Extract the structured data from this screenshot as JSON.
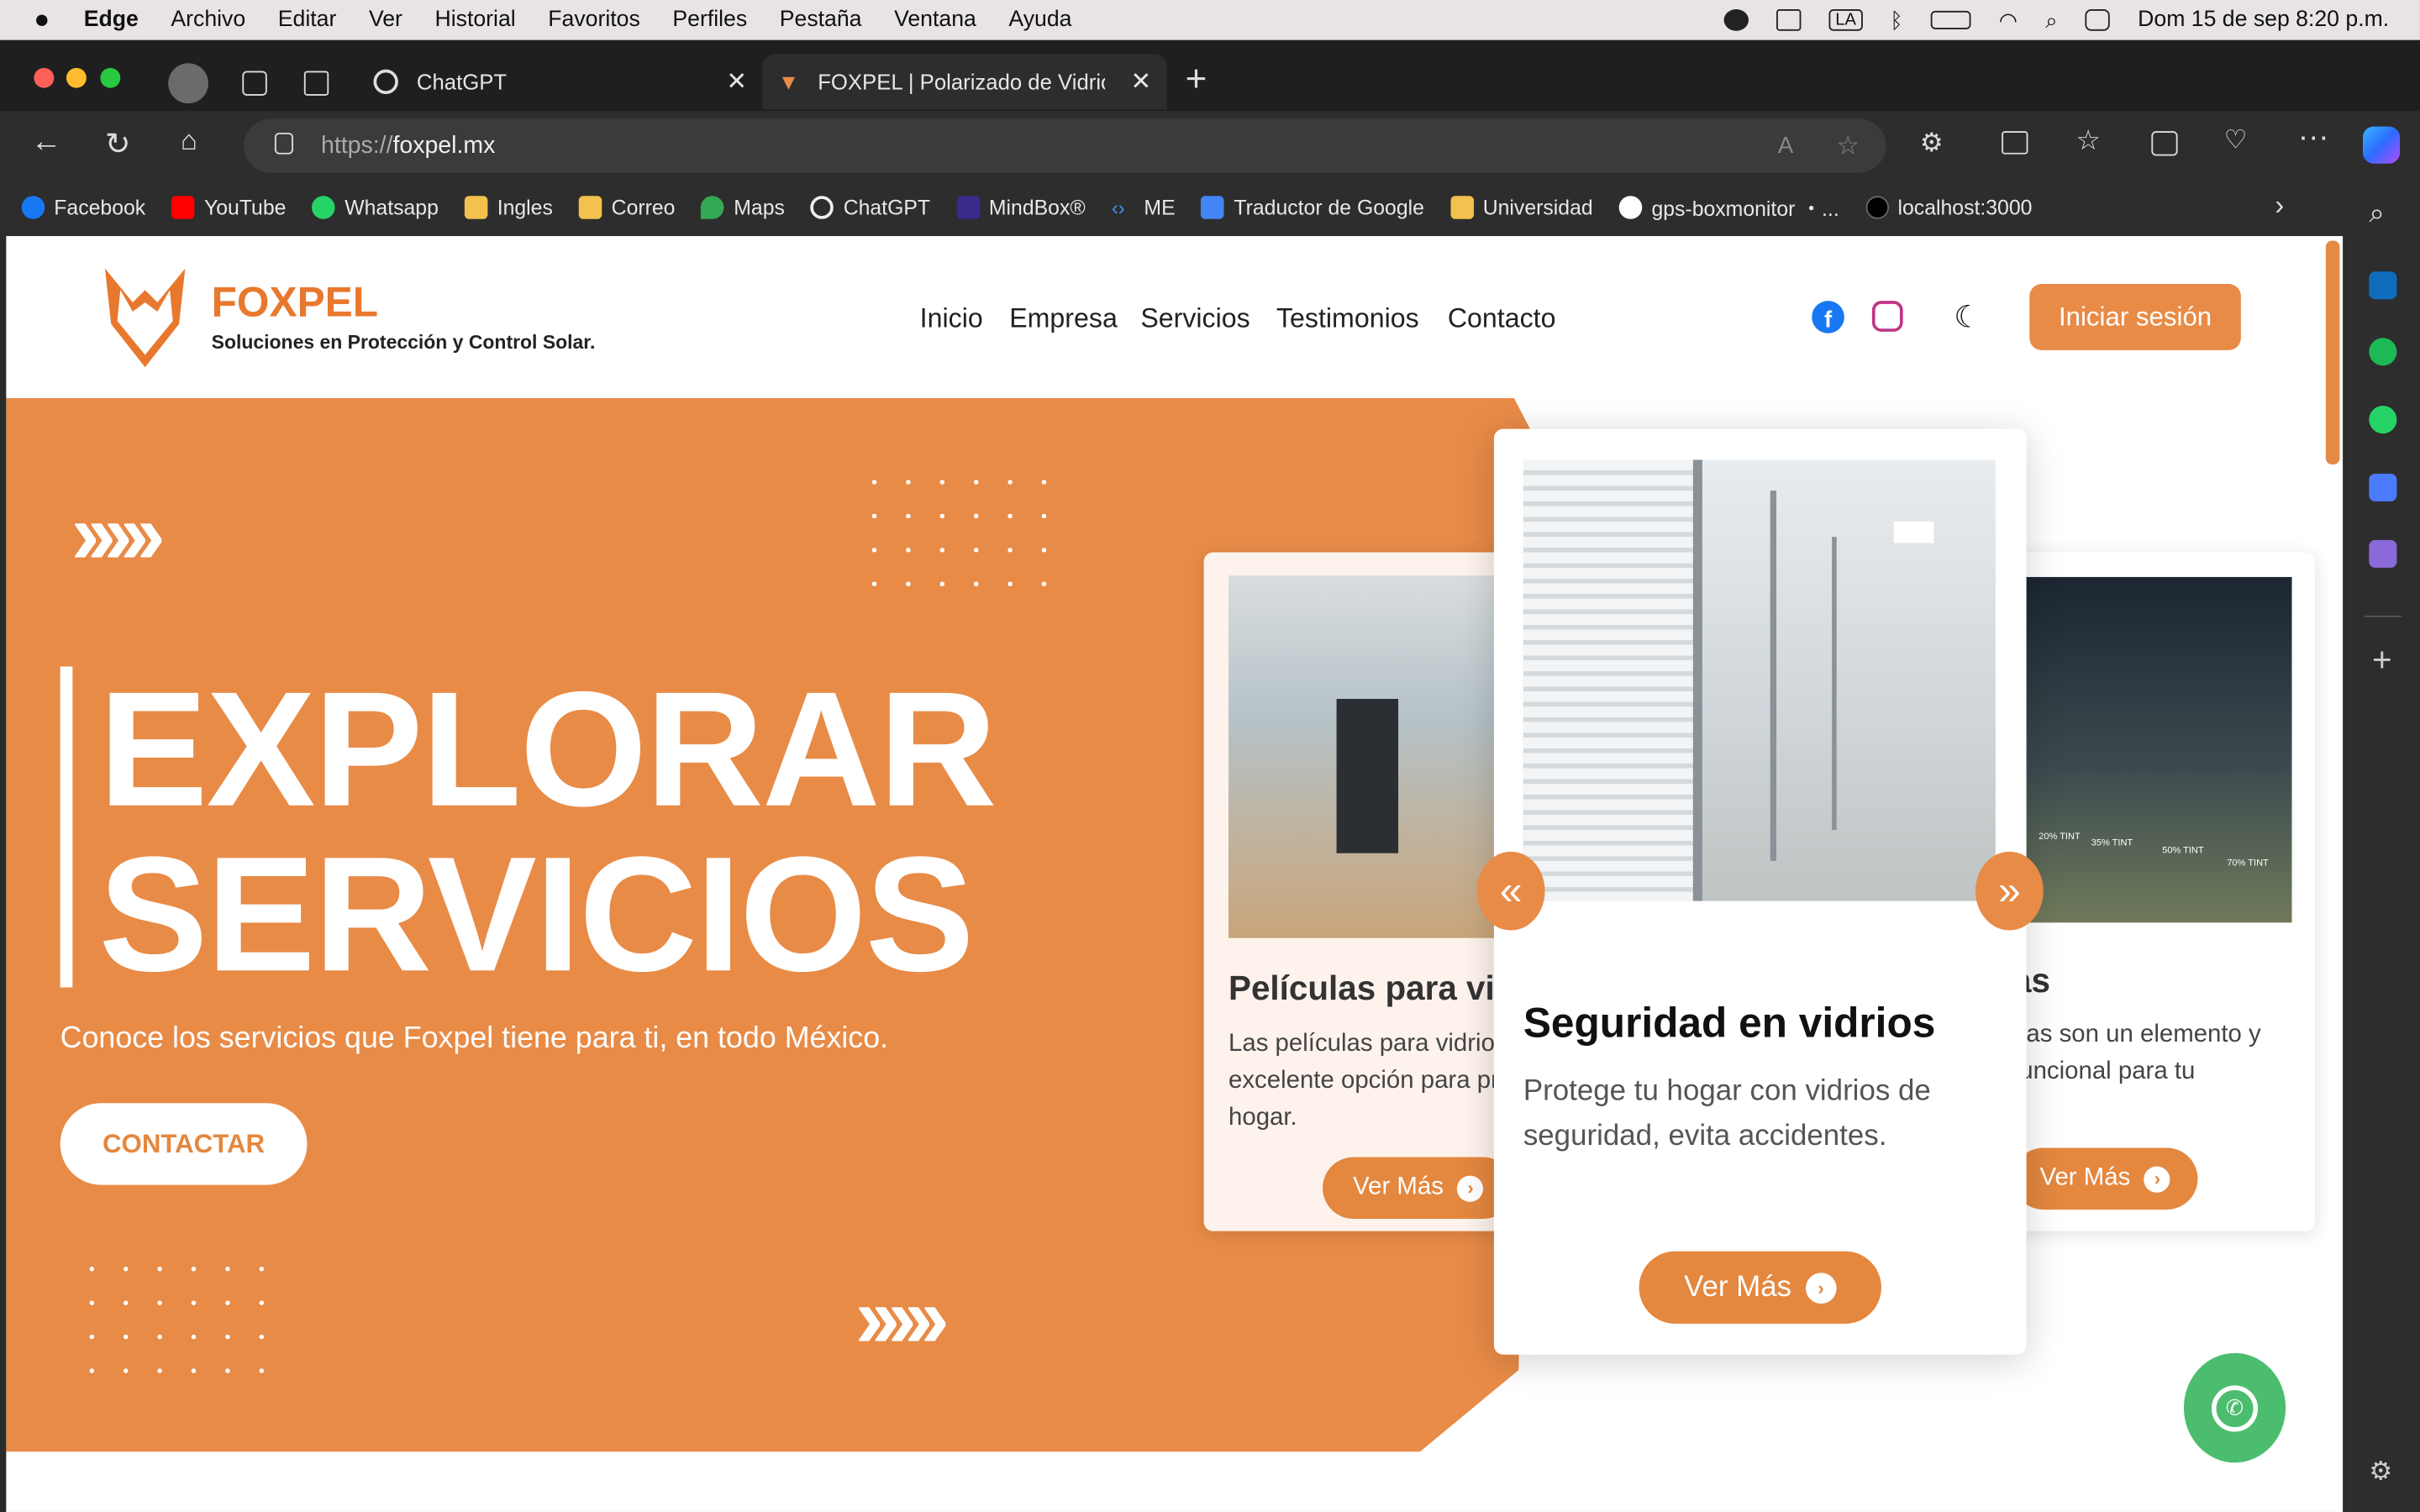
{
  "menubar": {
    "app": "Edge",
    "items": [
      "Archivo",
      "Editar",
      "Ver",
      "Historial",
      "Favoritos",
      "Perfiles",
      "Pestaña",
      "Ventana",
      "Ayuda"
    ],
    "clock": "Dom 15 de sep 8:20 p.m.",
    "input_source": "LA"
  },
  "tabs": [
    {
      "title": "ChatGPT",
      "icon": "chatgpt-icon"
    },
    {
      "title": "FOXPEL | Polarizado de Vidrio -",
      "icon": "foxpel-icon"
    }
  ],
  "address": {
    "url_prefix": "https://",
    "url_host": "foxpel.mx"
  },
  "bookmarks": [
    {
      "label": "Facebook",
      "color": "#1877f2"
    },
    {
      "label": "YouTube",
      "color": "#ff0000"
    },
    {
      "label": "Whatsapp",
      "color": "#25d366"
    },
    {
      "label": "Ingles",
      "color": "#f2c14e"
    },
    {
      "label": "Correo",
      "color": "#f2c14e"
    },
    {
      "label": "Maps",
      "color": "#34a853"
    },
    {
      "label": "ChatGPT",
      "color": "#ffffff"
    },
    {
      "label": "MindBox®",
      "color": "#3a2a8c"
    },
    {
      "label": "ME",
      "color": "#4a8cff"
    },
    {
      "label": "Traductor de Google",
      "color": "#4285f4"
    },
    {
      "label": "Universidad",
      "color": "#f2c14e"
    },
    {
      "label": "gps-boxmonitor ・...",
      "color": "#ffffff"
    },
    {
      "label": "localhost:3000",
      "color": "#000000"
    }
  ],
  "site": {
    "brand": "FOXPEL",
    "tagline": "Soluciones en Protección y Control Solar.",
    "nav": [
      "Inicio",
      "Empresa",
      "Servicios",
      "Testimonios",
      "Contacto"
    ],
    "login": "Iniciar sesión",
    "accent": "#e88b47",
    "hero": {
      "title_line1": "EXPLORAR",
      "title_line2": "SERVICIOS",
      "subtitle": "Conoce los servicios que Foxpel tiene para ti, en todo México.",
      "cta": "CONTACTAR"
    },
    "cards": {
      "left": {
        "title": "Películas para vi",
        "text": "Las películas para vidrio excelente opción para pr hogar.",
        "button": "Ver Más"
      },
      "center": {
        "title": "Seguridad en vidrios",
        "text": "Protege tu hogar con vidrios de seguridad, evita accidentes.",
        "button": "Ver Más"
      },
      "right": {
        "title": "as",
        "text": "nas son un elemento y funcional para tu",
        "button": "Ver Más"
      }
    },
    "tint_labels": [
      "20% TINT",
      "35% TINT",
      "50% TINT",
      "70% TINT"
    ],
    "prev_symbol": "«",
    "next_symbol": "»"
  }
}
